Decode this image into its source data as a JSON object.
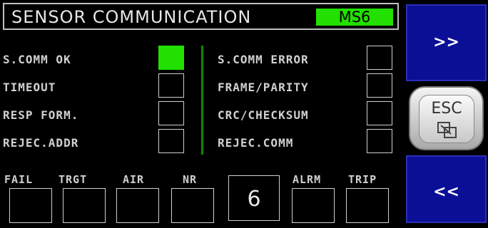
{
  "header": {
    "title": "SENSOR COMMUNICATION",
    "unit": "MS6"
  },
  "status_left": [
    {
      "label": "S.COMM OK",
      "active": true
    },
    {
      "label": "TIMEOUT",
      "active": false
    },
    {
      "label": "RESP FORM.",
      "active": false
    },
    {
      "label": "REJEC.ADDR",
      "active": false
    }
  ],
  "status_right": [
    {
      "label": "S.COMM ERROR",
      "active": false
    },
    {
      "label": "FRAME/PARITY",
      "active": false
    },
    {
      "label": "CRC/CHECKSUM",
      "active": false
    },
    {
      "label": "REJEC.COMM",
      "active": false
    }
  ],
  "bottom": {
    "labels": [
      "FAIL",
      "TRGT",
      "AIR",
      "NR",
      "ALRM",
      "TRIP"
    ],
    "value": "6"
  },
  "nav": {
    "next_label": ">>",
    "esc_label": "ESC",
    "prev_label": "<<"
  },
  "colors": {
    "active": "#22e000",
    "nav_button": "#0a0f96",
    "divider": "#118a00"
  }
}
